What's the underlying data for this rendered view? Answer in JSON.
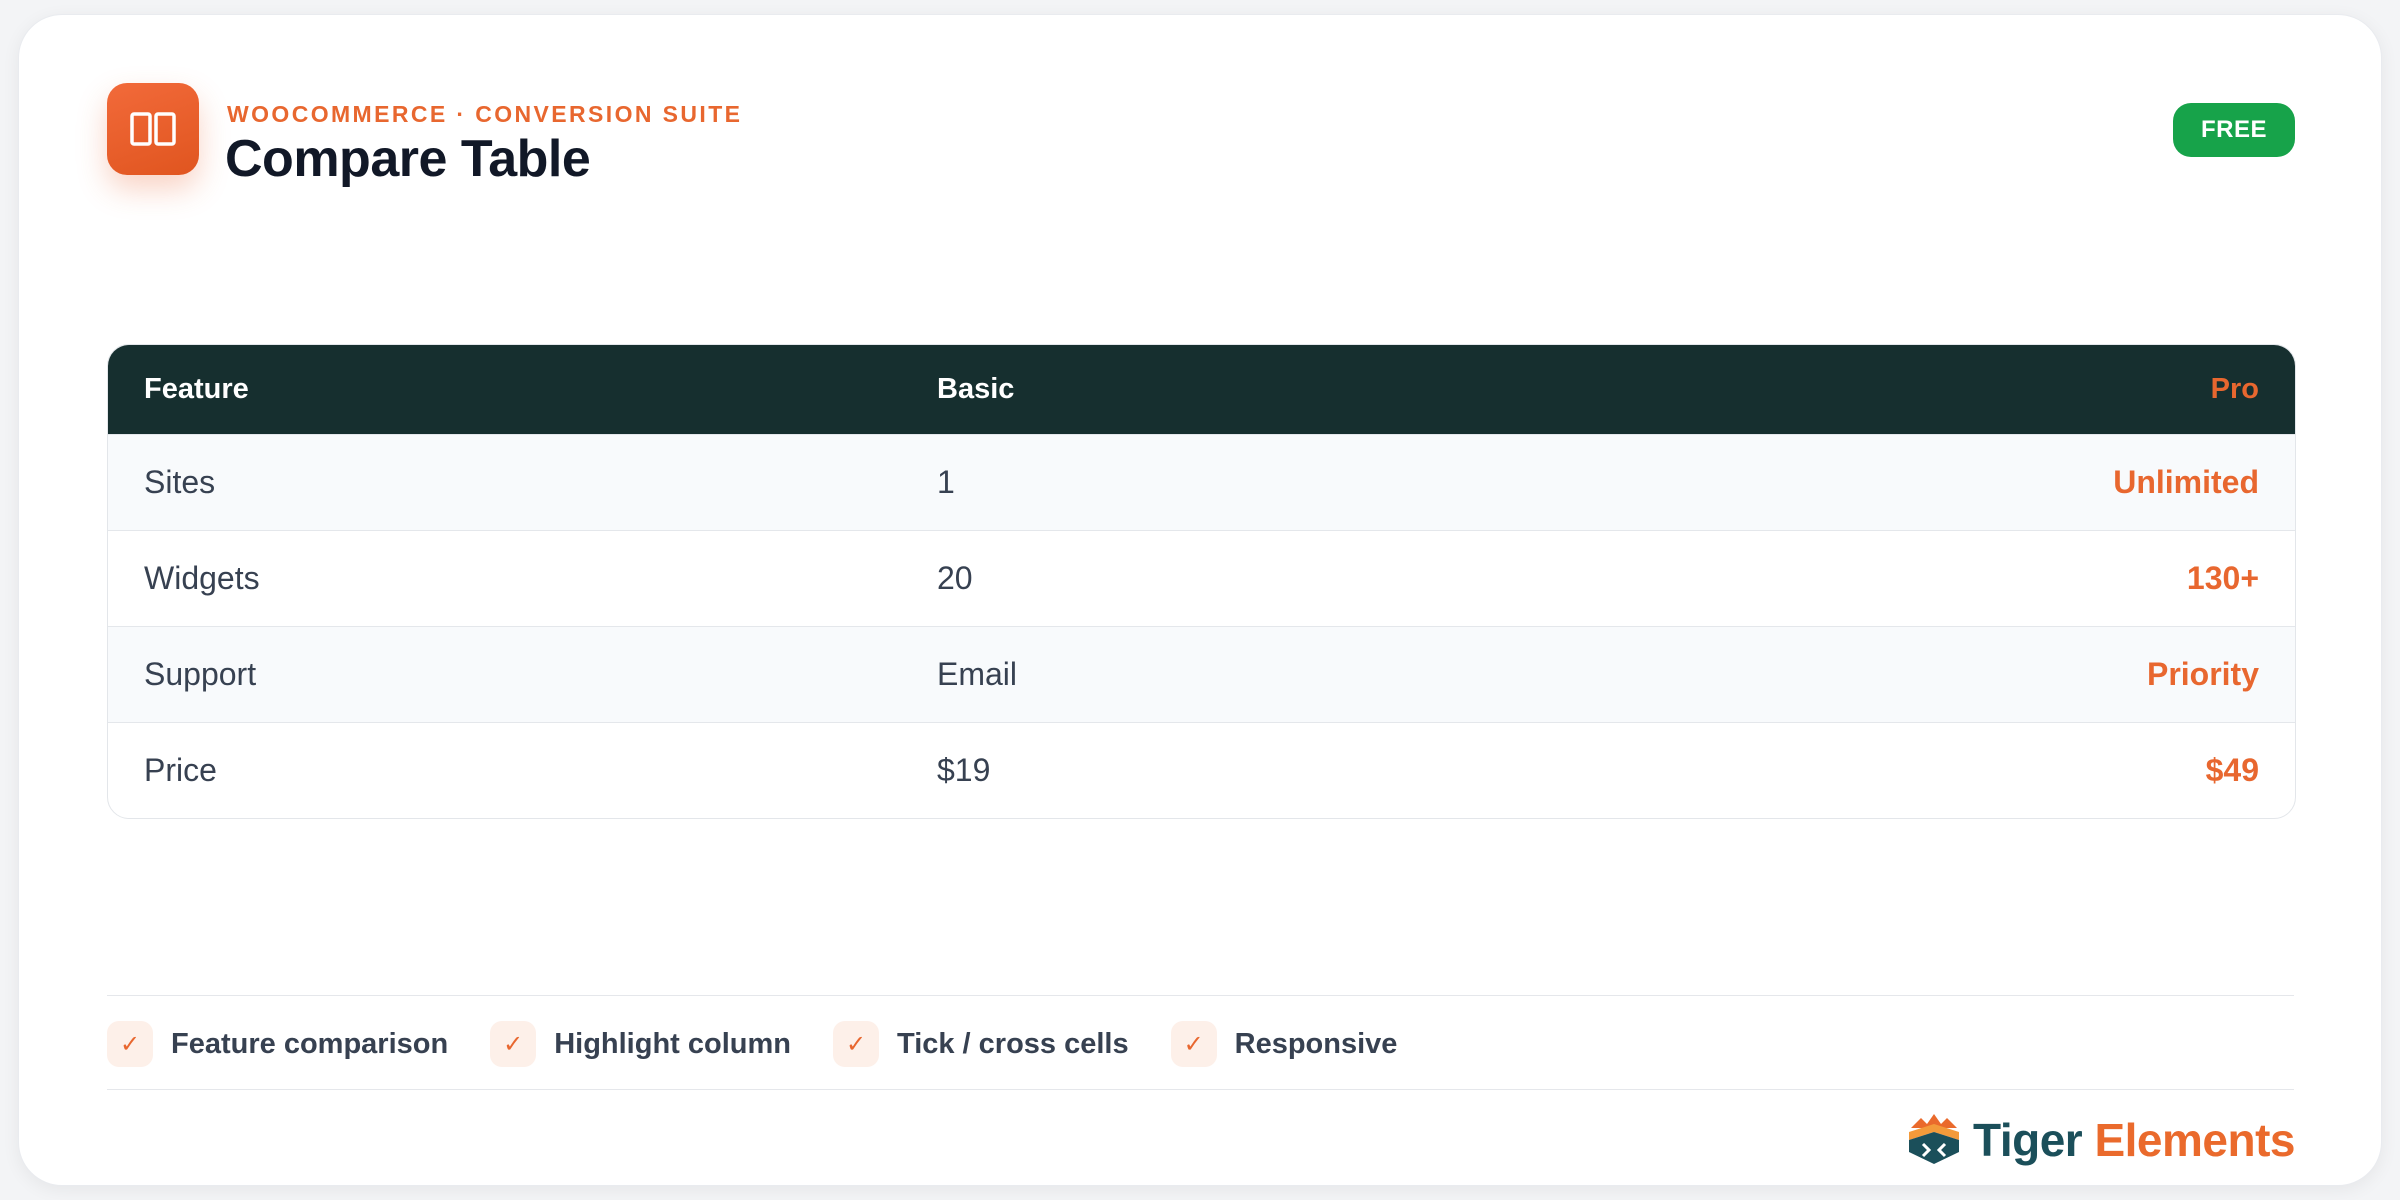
{
  "header": {
    "eyebrow": "WOOCOMMERCE · CONVERSION SUITE",
    "title": "Compare Table",
    "badge": "FREE",
    "icon": "columns-icon"
  },
  "table": {
    "columns": [
      "Feature",
      "Basic",
      "Pro"
    ],
    "rows": [
      [
        "Sites",
        "1",
        "Unlimited"
      ],
      [
        "Widgets",
        "20",
        "130+"
      ],
      [
        "Support",
        "Email",
        "Priority"
      ],
      [
        "Price",
        "$19",
        "$49"
      ]
    ],
    "header_color": "#162f2f",
    "highlight_color": "#e8672f"
  },
  "features": [
    {
      "icon": "check-icon",
      "label": "Feature comparison"
    },
    {
      "icon": "check-icon",
      "label": "Highlight column"
    },
    {
      "icon": "check-icon",
      "label": "Tick / cross cells"
    },
    {
      "icon": "check-icon",
      "label": "Responsive"
    }
  ],
  "brand": {
    "name_part1": "Tiger",
    "name_part2": "Elements",
    "icon": "tiger-elements-logo-icon"
  },
  "colors": {
    "accent": "#e8672f",
    "badge": "#17a34a",
    "brand_dark": "#1b4f5a"
  }
}
